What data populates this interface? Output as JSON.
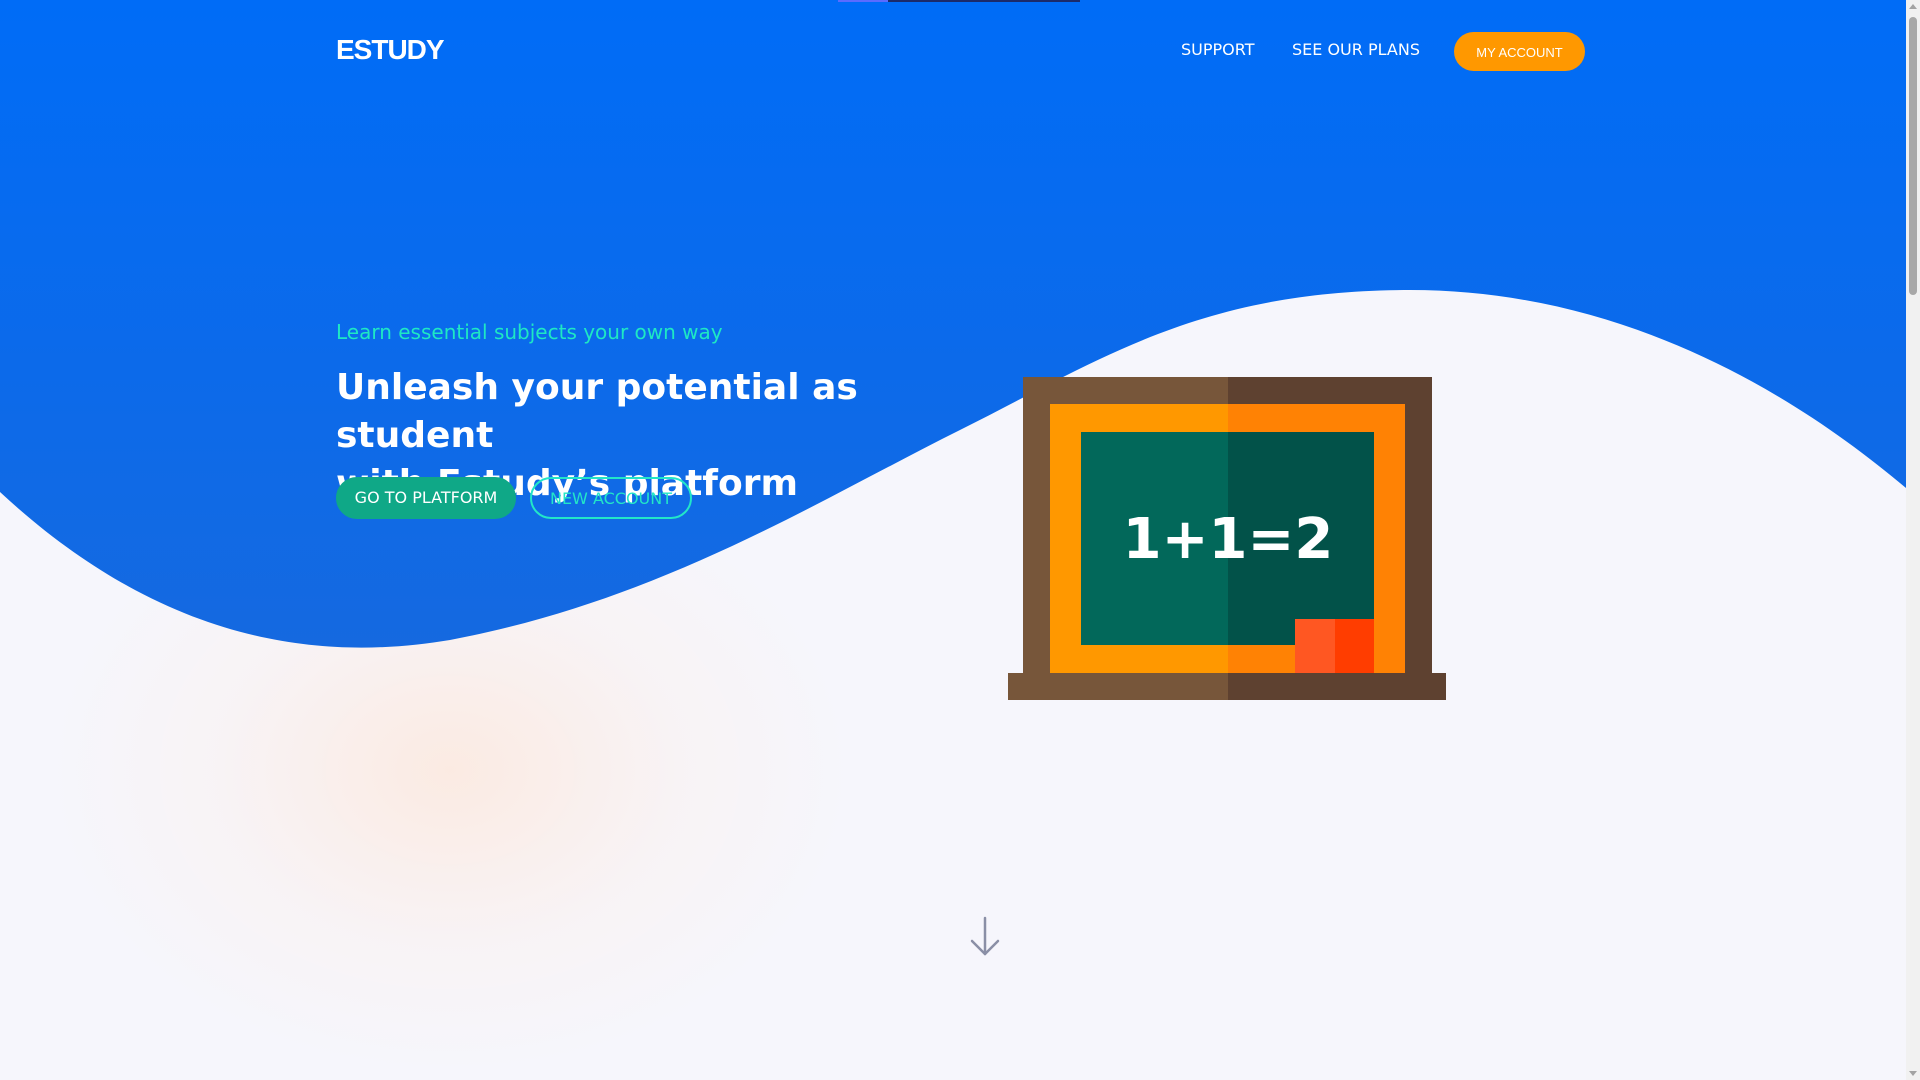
{
  "header": {
    "logo": "ESTUDY",
    "nav": {
      "support": "SUPPORT",
      "plans": "SEE OUR PLANS"
    },
    "account_button": "MY ACCOUNT"
  },
  "hero": {
    "eyebrow": "Learn essential subjects your own way",
    "headline_line1": "Unleash your potential as student",
    "headline_line2": "with Estudy’s platform",
    "primary_button": "GO TO PLATFORM",
    "secondary_button": "NEW ACCOUNT"
  },
  "illustration": {
    "equation": "1+1=2",
    "icon": "chalkboard-icon"
  },
  "scroll_hint": {
    "icon": "arrow-down-icon"
  },
  "colors": {
    "brand_blue": "#006dff",
    "accent_orange": "#ff9800",
    "teal": "#0fa887",
    "mint": "#22e6c8",
    "background": "#f6f6fc"
  }
}
